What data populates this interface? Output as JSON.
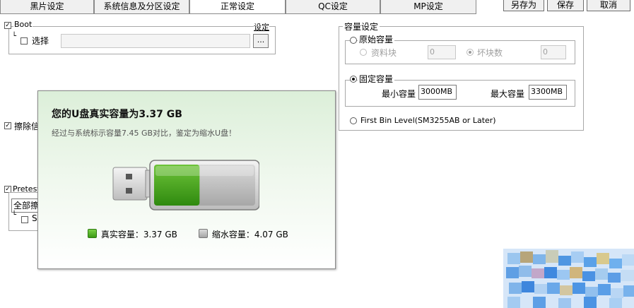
{
  "tabs": [
    {
      "label": "黑片设定"
    },
    {
      "label": "系统信息及分区设定"
    },
    {
      "label": "正常设定"
    },
    {
      "label": "QC设定"
    },
    {
      "label": "MP设定"
    }
  ],
  "actions": {
    "save_as": "另存为",
    "save": "保存",
    "cancel": "取消"
  },
  "boot": {
    "label": "Boot",
    "set_label": "设定",
    "select_label": "选择",
    "browse_label": "..."
  },
  "erase": {
    "label_partial": "擦除信"
  },
  "pretest": {
    "label_partial": "Pretest",
    "dropdown_partial": "全部擦",
    "sub_label_partial": "S"
  },
  "capacity": {
    "group_title": "容量设定",
    "original_label": "原始容量",
    "material_block_label": "资料块",
    "material_block_value": "0",
    "bad_block_label": "坏块数",
    "bad_block_value": "0",
    "fixed_label": "固定容量",
    "min_label": "最小容量",
    "min_value": "3000MB",
    "max_label": "最大容量",
    "max_value": "3300MB",
    "firstbin_label": "First Bin Level(SM3255AB or Later)"
  },
  "popup": {
    "title": "您的U盘真实容量为3.37 GB",
    "subtitle": "经过与系统标示容量7.45 GB对比，鉴定为缩水U盘！",
    "real_fraction": 0.45,
    "legend_real": "真实容量：3.37 GB",
    "legend_shrink": "缩水容量：4.07 GB",
    "colors": {
      "real": "#44a01a",
      "shrink": "#b9b9b9"
    }
  }
}
